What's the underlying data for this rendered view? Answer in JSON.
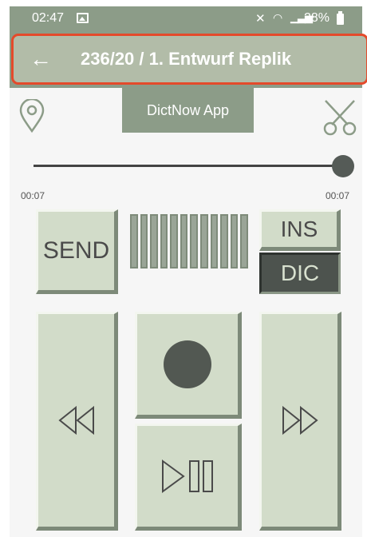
{
  "status_bar": {
    "time": "02:47",
    "battery": "28%",
    "icons": [
      "image-icon",
      "mute-icon",
      "wifi-icon",
      "signal-icon",
      "battery-icon"
    ]
  },
  "app_bar": {
    "title": "236/20 / 1. Entwurf Replik",
    "back_icon": "arrow-left-icon",
    "highlight_color": "#e44a2b"
  },
  "toolbar": {
    "app_button_label": "DictNow App",
    "location_icon": "map-pin-icon",
    "cut_icon": "scissors-icon"
  },
  "player": {
    "position": "00:07",
    "duration": "00:07",
    "progress": 1.0
  },
  "controls": {
    "send_label": "SEND",
    "ins_label": "INS",
    "dic_label": "DIC",
    "active_mode": "DIC",
    "record_icon": "record-icon",
    "rewind_icon": "rewind-icon",
    "play_pause_icon": "play-pause-icon",
    "forward_icon": "fast-forward-icon"
  },
  "colors": {
    "bar": "#8c9c88",
    "button_face": "#d2dcc9",
    "active_button": "#4d534e"
  }
}
